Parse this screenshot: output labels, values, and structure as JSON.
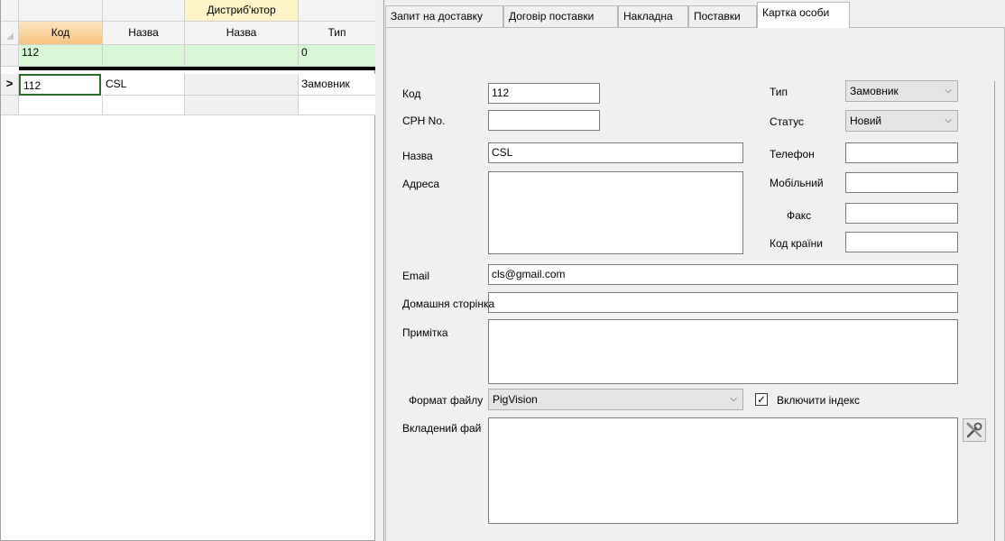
{
  "grid": {
    "band_header": "Дистриб'ютор",
    "columns": [
      "Код",
      "Назва",
      "Назва",
      "Тип"
    ],
    "filter_row": [
      "112",
      "",
      "",
      "0"
    ],
    "row_indicator": ">",
    "rows": [
      [
        "112",
        "CSL",
        "",
        "Замовник"
      ]
    ]
  },
  "tabs": [
    "Запит на доставку",
    "Договір поставки",
    "Накладна",
    "Поставки",
    "Картка особи"
  ],
  "active_tab": "Картка особи",
  "form": {
    "code_label": "Код",
    "code_value": "112",
    "cph_label": "CPH No.",
    "cph_value": "",
    "name_label": "Назва",
    "name_value": "CSL",
    "address_label": "Адреса",
    "address_value": "",
    "type_label": "Тип",
    "type_value": "Замовник",
    "status_label": "Статус",
    "status_value": "Новий",
    "phone_label": "Телефон",
    "mobile_label": "Мобільний",
    "fax_label": "Факс",
    "country_code_label": "Код країни",
    "email_label": "Email",
    "email_value": "cls@gmail.com",
    "homepage_label": "Домашня сторінка",
    "note_label": "Примітка",
    "file_format_label": "Формат файлу",
    "file_format_value": "PigVision",
    "include_index_label": "Включити індекс",
    "include_index_checked": "✓",
    "attached_file_label": "Вкладений фай"
  }
}
